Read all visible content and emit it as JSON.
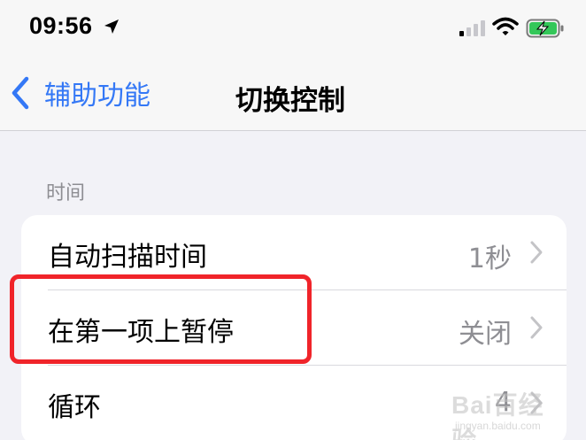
{
  "status_bar": {
    "time": "09:56",
    "icons": [
      "location-arrow-icon",
      "cellular-signal-icon",
      "wifi-icon",
      "battery-charging-icon"
    ]
  },
  "nav": {
    "back_label": "辅助功能",
    "title": "切换控制"
  },
  "section": {
    "header": "时间",
    "rows": [
      {
        "label": "自动扫描时间",
        "value": "1秒"
      },
      {
        "label": "在第一项上暂停",
        "value": "关闭"
      },
      {
        "label": "循环",
        "value": "4"
      }
    ]
  },
  "colors": {
    "accent": "#3478f6",
    "highlight": "#f0242a",
    "background": "#f2f2f7",
    "secondary_text": "#8e8e93"
  },
  "watermark": {
    "brand": "Bai百经验",
    "url": "jingyan.baidu.com"
  }
}
